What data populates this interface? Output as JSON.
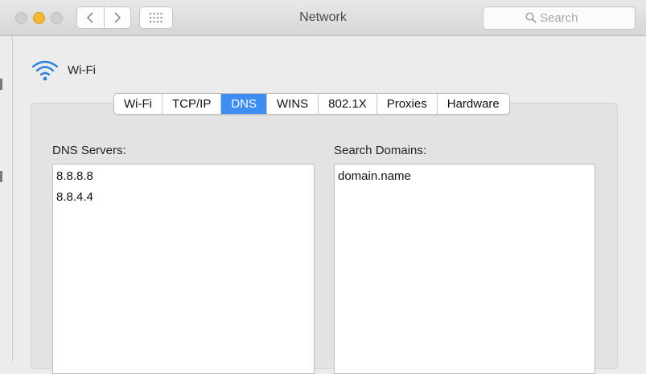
{
  "window": {
    "title": "Network"
  },
  "search": {
    "placeholder": "Search"
  },
  "nav": {
    "back_icon": "chevron-left-icon",
    "forward_icon": "chevron-right-icon",
    "grid_icon": "grid-icon"
  },
  "interface": {
    "name": "Wi-Fi",
    "icon": "wifi-icon"
  },
  "tabs": [
    {
      "label": "Wi-Fi",
      "active": false
    },
    {
      "label": "TCP/IP",
      "active": false
    },
    {
      "label": "DNS",
      "active": true
    },
    {
      "label": "WINS",
      "active": false
    },
    {
      "label": "802.1X",
      "active": false
    },
    {
      "label": "Proxies",
      "active": false
    },
    {
      "label": "Hardware",
      "active": false
    }
  ],
  "dns_servers": {
    "label": "DNS Servers:",
    "items": [
      "8.8.8.8",
      "8.8.4.4"
    ]
  },
  "search_domains": {
    "label": "Search Domains:",
    "items": [
      "domain.name"
    ]
  },
  "colors": {
    "accent": "#3d8ef0",
    "minimize": "#f5b731",
    "wifi": "#2b7fe0"
  }
}
